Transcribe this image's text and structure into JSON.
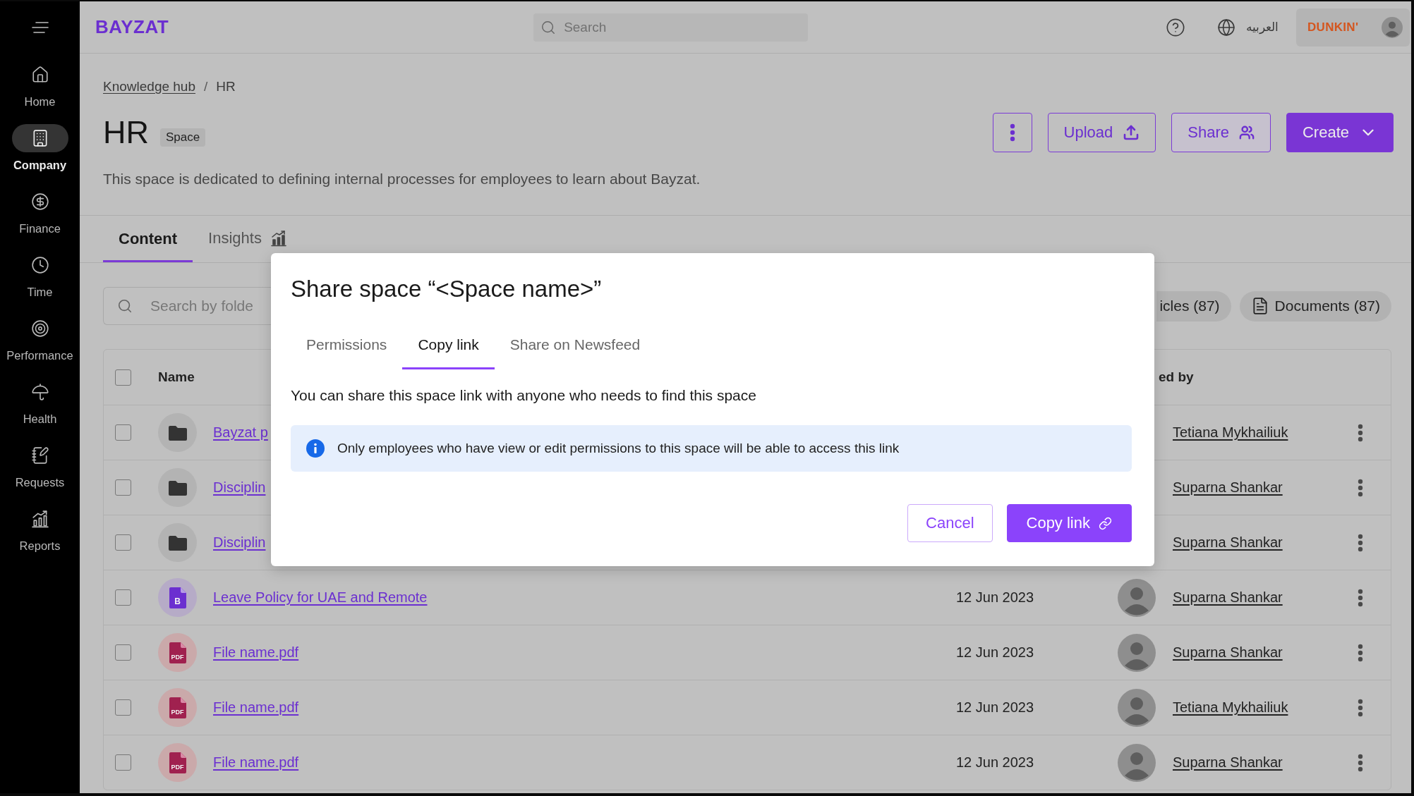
{
  "sidebar": {
    "items": [
      {
        "label": "Home",
        "selected": false
      },
      {
        "label": "Company",
        "selected": true
      },
      {
        "label": "Finance",
        "selected": false
      },
      {
        "label": "Time",
        "selected": false
      },
      {
        "label": "Performance",
        "selected": false
      },
      {
        "label": "Health",
        "selected": false
      },
      {
        "label": "Requests",
        "selected": false
      },
      {
        "label": "Reports",
        "selected": false
      }
    ]
  },
  "topbar": {
    "logo": "BAYZAT",
    "search": {
      "placeholder": "Search"
    },
    "language": "العربيه",
    "account": {
      "logo": "DUNKIN'"
    }
  },
  "breadcrumb": {
    "separator": "/",
    "items": [
      {
        "label": "Knowledge hub",
        "kind": "link"
      },
      {
        "label": "HR",
        "kind": "current"
      }
    ]
  },
  "header": {
    "title": "HR",
    "badge": "Space",
    "description": "This space is dedicated to defining internal processes for employees to learn about Bayzat.",
    "actions": [
      {
        "kind": "menu"
      },
      {
        "kind": "upload",
        "label": "Upload"
      },
      {
        "kind": "share",
        "label": "Share"
      },
      {
        "kind": "create",
        "label": "Create"
      }
    ]
  },
  "tabs": [
    {
      "label": "Content",
      "selected": true,
      "kind": "plain"
    },
    {
      "label": "Insights",
      "selected": false,
      "kind": "chart"
    }
  ],
  "filters": {
    "search": {
      "placeholder": "Search by folde"
    },
    "chips": [
      {
        "label": "icles (87)",
        "partly_hidden": true
      },
      {
        "label": "Documents (87)",
        "partly_hidden": false
      }
    ]
  },
  "table": {
    "select_all": {
      "checked": false
    },
    "columns": [
      {
        "label": "Name"
      },
      {
        "label": "ed by"
      }
    ],
    "rows": [
      {
        "checked": false,
        "kind": "folder",
        "name": "Bayzat p",
        "owner": "Tetiana Mykhailiuk"
      },
      {
        "checked": false,
        "kind": "folder",
        "name": "Disciplin",
        "owner": "Suparna Shankar"
      },
      {
        "checked": false,
        "kind": "folder",
        "name": "Disciplin",
        "owner": "Suparna Shankar"
      },
      {
        "checked": false,
        "kind": "article",
        "icon_label": "B",
        "name": "Leave Policy for UAE and Remote",
        "date": "12 Jun 2023",
        "owner": "Suparna Shankar"
      },
      {
        "checked": false,
        "kind": "pdf",
        "icon_label": "PDF",
        "name": "File name.pdf",
        "date": "12 Jun 2023",
        "owner": "Suparna Shankar"
      },
      {
        "checked": false,
        "kind": "pdf",
        "icon_label": "PDF",
        "name": "File name.pdf",
        "date": "12 Jun 2023",
        "owner": "Tetiana Mykhailiuk"
      },
      {
        "checked": false,
        "kind": "pdf",
        "icon_label": "PDF",
        "name": "File name.pdf",
        "date": "12 Jun 2023",
        "owner": "Suparna Shankar"
      }
    ]
  },
  "modal": {
    "title": "Share space “<Space name>”",
    "tabs": [
      {
        "label": "Permissions",
        "selected": false
      },
      {
        "label": "Copy link",
        "selected": true
      },
      {
        "label": "Share on Newsfeed",
        "selected": false
      }
    ],
    "text": "You can share this space link with anyone who needs to find this space",
    "info": "Only employees who have view or edit permissions to this space will be able to access this link",
    "buttons": [
      {
        "label": "Cancel",
        "kind": "secondary"
      },
      {
        "label": "Copy link",
        "kind": "primary"
      }
    ]
  }
}
